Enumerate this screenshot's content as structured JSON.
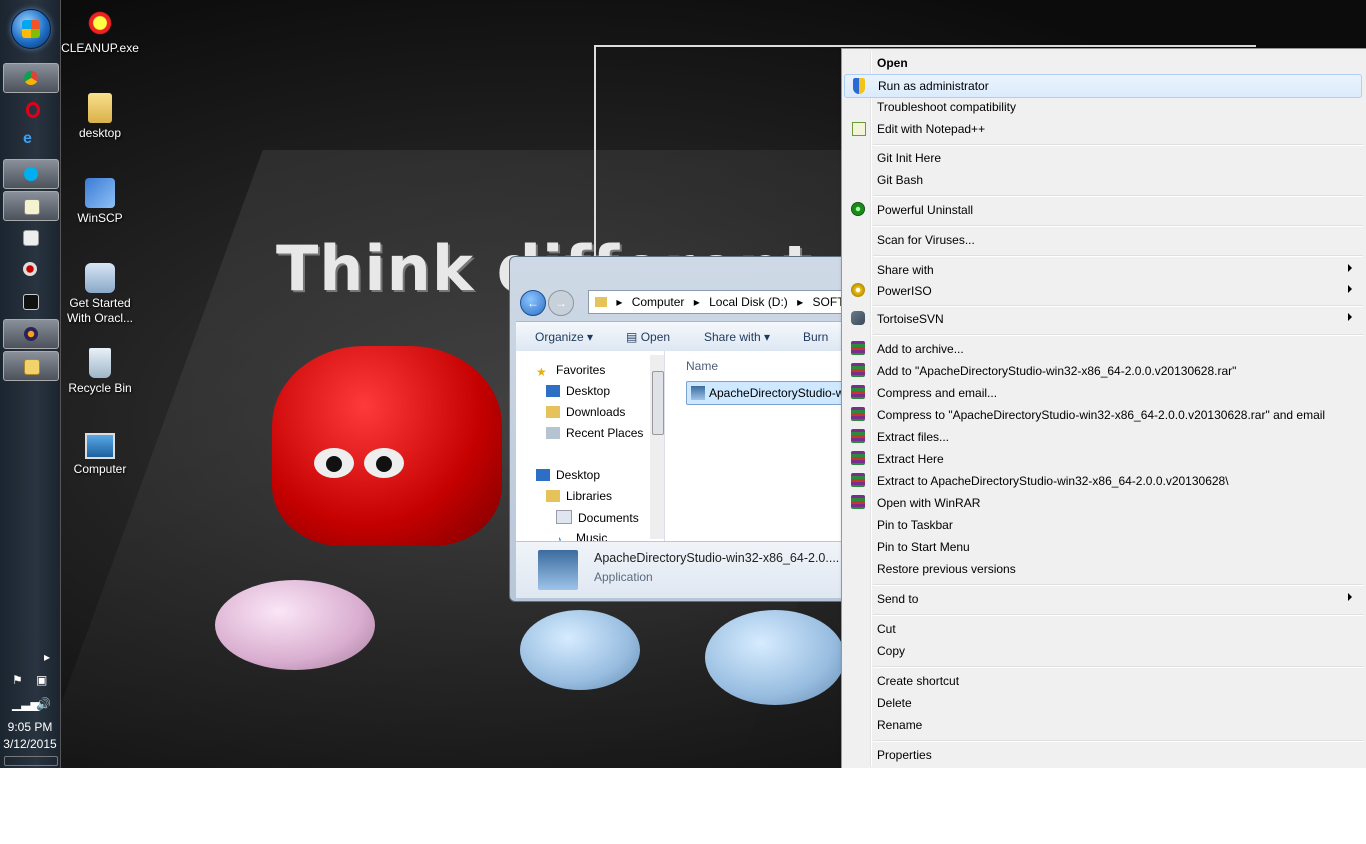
{
  "desktop": {
    "wallpaper_text": "Think different",
    "icons": [
      {
        "label": "CLEANUP.exe",
        "icon": "cleanup-app-icon"
      },
      {
        "label": "desktop",
        "icon": "folder-icon"
      },
      {
        "label": "WinSCP",
        "icon": "winscp-icon"
      },
      {
        "label": "Get Started With Oracl...",
        "icon": "oracle-db-icon"
      },
      {
        "label": "Recycle Bin",
        "icon": "recycle-bin-icon"
      },
      {
        "label": "Computer",
        "icon": "computer-icon"
      }
    ]
  },
  "taskbar": {
    "clock_time": "9:05 PM",
    "clock_date": "3/12/2015",
    "buttons": [
      "chrome-icon",
      "opera-icon",
      "internet-explorer-icon",
      "skype-icon",
      "notepad-icon",
      "window-icon",
      "record-icon",
      "cmd-icon",
      "eclipse-icon",
      "explorer-icon"
    ]
  },
  "explorer": {
    "breadcrumb": [
      "Computer",
      "Local Disk (D:)",
      "SOFTW"
    ],
    "commands": {
      "organize": "Organize",
      "open": "Open",
      "share_with": "Share with",
      "burn": "Burn"
    },
    "nav": {
      "favorites": "Favorites",
      "desktop_fav": "Desktop",
      "downloads": "Downloads",
      "recent_places": "Recent Places",
      "desktop": "Desktop",
      "libraries": "Libraries",
      "documents": "Documents",
      "music": "Music"
    },
    "column_name": "Name",
    "selected_file": "ApacheDirectoryStudio-w",
    "details_name": "ApacheDirectoryStudio-win32-x86_64-2.0....",
    "details_type": "Application"
  },
  "context_menu": {
    "items": [
      {
        "label": "Open",
        "bold": true
      },
      {
        "label": "Run as administrator",
        "icon": "shield-icon",
        "highlighted": true
      },
      {
        "label": "Troubleshoot compatibility"
      },
      {
        "label": "Edit with Notepad++",
        "icon": "notepadpp-icon"
      },
      {
        "label": "Git Init Here"
      },
      {
        "label": "Git Bash"
      },
      {
        "label": "Powerful Uninstall",
        "icon": "uninstall-icon"
      },
      {
        "label": "Scan for Viruses..."
      },
      {
        "label": "Share with",
        "submenu": true
      },
      {
        "label": "PowerISO",
        "icon": "poweriso-icon",
        "submenu": true
      },
      {
        "label": "TortoiseSVN",
        "icon": "tortoisesvn-icon",
        "submenu": true
      },
      {
        "label": "Add to archive...",
        "icon": "winrar-icon"
      },
      {
        "label": "Add to \"ApacheDirectoryStudio-win32-x86_64-2.0.0.v20130628.rar\"",
        "icon": "winrar-icon"
      },
      {
        "label": "Compress and email...",
        "icon": "winrar-icon"
      },
      {
        "label": "Compress to \"ApacheDirectoryStudio-win32-x86_64-2.0.0.v20130628.rar\" and email",
        "icon": "winrar-icon"
      },
      {
        "label": "Extract files...",
        "icon": "winrar-icon"
      },
      {
        "label": "Extract Here",
        "icon": "winrar-icon"
      },
      {
        "label": "Extract to ApacheDirectoryStudio-win32-x86_64-2.0.0.v20130628\\",
        "icon": "winrar-icon"
      },
      {
        "label": "Open with WinRAR",
        "icon": "winrar-icon"
      },
      {
        "label": "Pin to Taskbar"
      },
      {
        "label": "Pin to Start Menu"
      },
      {
        "label": "Restore previous versions"
      },
      {
        "label": "Send to",
        "submenu": true
      },
      {
        "label": "Cut"
      },
      {
        "label": "Copy"
      },
      {
        "label": "Create shortcut"
      },
      {
        "label": "Delete"
      },
      {
        "label": "Rename"
      },
      {
        "label": "Properties"
      }
    ]
  }
}
